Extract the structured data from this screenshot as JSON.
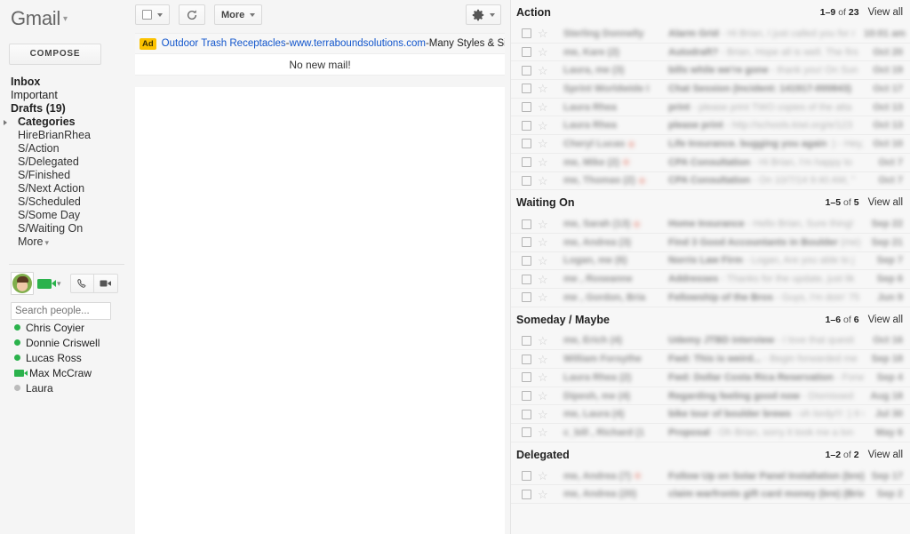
{
  "sidebar": {
    "logo": "Gmail",
    "compose_label": "COMPOSE",
    "nav": [
      {
        "label": "Inbox",
        "bold": true,
        "sub": false,
        "expander": false,
        "caret": false
      },
      {
        "label": "Important",
        "bold": false,
        "sub": false,
        "expander": false,
        "caret": false
      },
      {
        "label": "Drafts (19)",
        "bold": true,
        "sub": false,
        "expander": false,
        "caret": false
      },
      {
        "label": "Categories",
        "bold": true,
        "sub": false,
        "expander": true,
        "caret": false
      },
      {
        "label": "HireBrianRhea",
        "bold": false,
        "sub": true,
        "expander": false,
        "caret": false
      },
      {
        "label": "S/Action",
        "bold": false,
        "sub": true,
        "expander": false,
        "caret": false
      },
      {
        "label": "S/Delegated",
        "bold": false,
        "sub": true,
        "expander": false,
        "caret": false
      },
      {
        "label": "S/Finished",
        "bold": false,
        "sub": true,
        "expander": false,
        "caret": false
      },
      {
        "label": "S/Next Action",
        "bold": false,
        "sub": true,
        "expander": false,
        "caret": false
      },
      {
        "label": "S/Scheduled",
        "bold": false,
        "sub": true,
        "expander": false,
        "caret": false
      },
      {
        "label": "S/Some Day",
        "bold": false,
        "sub": true,
        "expander": false,
        "caret": false
      },
      {
        "label": "S/Waiting On",
        "bold": false,
        "sub": true,
        "expander": false,
        "caret": false
      },
      {
        "label": "More",
        "bold": false,
        "sub": true,
        "expander": false,
        "caret": true
      }
    ],
    "chat": {
      "search_placeholder": "Search people...",
      "contacts": [
        {
          "name": "Chris Coyier",
          "status": "available"
        },
        {
          "name": "Donnie Criswell",
          "status": "available"
        },
        {
          "name": "Lucas Ross",
          "status": "available"
        },
        {
          "name": "Max McCraw",
          "status": "video"
        },
        {
          "name": "Laura",
          "status": "idle"
        }
      ]
    }
  },
  "center": {
    "toolbar": {
      "select_icon": "checkbox-icon",
      "refresh_icon": "refresh-icon",
      "more_label": "More",
      "settings_icon": "gear-icon"
    },
    "ad": {
      "badge": "Ad",
      "title": "Outdoor Trash Receptacles",
      "sep1": " - ",
      "url": "www.terraboundsolutions.com",
      "sep2": " - ",
      "tail": "Many Styles & Siz"
    },
    "empty_state": "No new mail!"
  },
  "right": {
    "view_all_label": "View all",
    "sections": [
      {
        "title": "Action",
        "range": "1–9",
        "of": "of",
        "total": "23",
        "rows": [
          {
            "sender": "Sterling Donnelly",
            "subject": "Alarm Grid",
            "snippet": "- Hi Brian, I just called you for r",
            "date": "10:01 am",
            "attach": false
          },
          {
            "sender": "me, Kare (2)",
            "subject": "Autodraft?",
            "snippet": "- Brian, Hope all is well. The firs",
            "date": "Oct 20",
            "attach": false
          },
          {
            "sender": "Laura, me (3)",
            "subject": "bills while we're gone",
            "snippet": "- thank you! On Sun",
            "date": "Oct 19",
            "attach": false
          },
          {
            "sender": "Sprint Worldwide I",
            "subject": "Chat Session (Incident: 141917-000843)",
            "snippet": "",
            "date": "Oct 17",
            "attach": false
          },
          {
            "sender": "Laura Rhea",
            "subject": "print",
            "snippet": "- please print TWO copies of the atta",
            "date": "Oct 13",
            "attach": false
          },
          {
            "sender": "Laura Rhea",
            "subject": "please print",
            "snippet": "- http://schools.kiwi.org/e/123",
            "date": "Oct 13",
            "attach": false
          },
          {
            "sender": "Cheryl Lucas",
            "subject": "Life Insurance. bugging you again",
            "snippet": ":) - Hey, just",
            "date": "Oct 10",
            "attach": true
          },
          {
            "sender": "me, Mike (2)",
            "subject": "CPA Consultation",
            "snippet": "- Hi Brian, I'm happy to",
            "date": "Oct 7",
            "attach": true
          },
          {
            "sender": "me, Thomas (2)",
            "subject": "CPA Consultation",
            "snippet": "- On 10/7/14 9:40 AM, \"",
            "date": "Oct 7",
            "attach": true
          }
        ]
      },
      {
        "title": "Waiting On",
        "range": "1–5",
        "of": "of",
        "total": "5",
        "rows": [
          {
            "sender": "me, Sarah (13)",
            "subject": "Home Insurance",
            "snippet": "- Hello Brian, Sure thing!",
            "date": "Sep 22",
            "attach": true
          },
          {
            "sender": "me, Andrea (3)",
            "subject": "Find 3 Good Accountants in Boulder",
            "snippet": "(me)",
            "date": "Sep 21",
            "attach": false
          },
          {
            "sender": "Logan, me (6)",
            "subject": "Norris Law Firm",
            "snippet": "- Logan, Are you able to j",
            "date": "Sep 7",
            "attach": false
          },
          {
            "sender": "me , Roseanne",
            "subject": "Addresses",
            "snippet": "- Thanks for the update, just lik",
            "date": "Sep 6",
            "attach": false
          },
          {
            "sender": "me , Gordon, Bria",
            "subject": "Fellowship of the Bros",
            "snippet": "- Guys, I'm doin' 75",
            "date": "Jun 9",
            "attach": false
          }
        ]
      },
      {
        "title": "Someday / Maybe",
        "range": "1–6",
        "of": "of",
        "total": "6",
        "rows": [
          {
            "sender": "me, Erich (4)",
            "subject": "Udemy JTBD interview",
            "snippet": "- I love that questi",
            "date": "Oct 16",
            "attach": false
          },
          {
            "sender": "William Forsythe",
            "subject": "Fwd: This is weird...",
            "snippet": "- Begin forwarded me",
            "date": "Sep 18",
            "attach": false
          },
          {
            "sender": "Laura Rhea (2)",
            "subject": "Fwd: Dollar Costa Rica Reservation",
            "snippet": "- Forw",
            "date": "Sep 4",
            "attach": false
          },
          {
            "sender": "Dipesh, me (4)",
            "subject": "Regarding feeling good now",
            "snippet": "- Dismissed",
            "date": "Aug 18",
            "attach": false
          },
          {
            "sender": "me, Laura (4)",
            "subject": "bike tour of boulder brews",
            "snippet": "- oh lordy!!! :) It wa",
            "date": "Jul 30",
            "attach": false
          },
          {
            "sender": "c_bill , Richard (1",
            "subject": "Proposal",
            "snippet": "- Oh Brian, sorry it took me a lon",
            "date": "May 6",
            "attach": false
          }
        ]
      },
      {
        "title": "Delegated",
        "range": "1–2",
        "of": "of",
        "total": "2",
        "rows": [
          {
            "sender": "me, Andrea (7)",
            "subject": "Follow Up on Solar Panel Installation (bre)",
            "snippet": "",
            "date": "Sep 17",
            "attach": true
          },
          {
            "sender": "me, Andrea (20)",
            "subject": "claim warfronts gift card money (bre) (Bria",
            "snippet": "",
            "date": "Sep 2",
            "attach": false
          }
        ]
      }
    ]
  }
}
